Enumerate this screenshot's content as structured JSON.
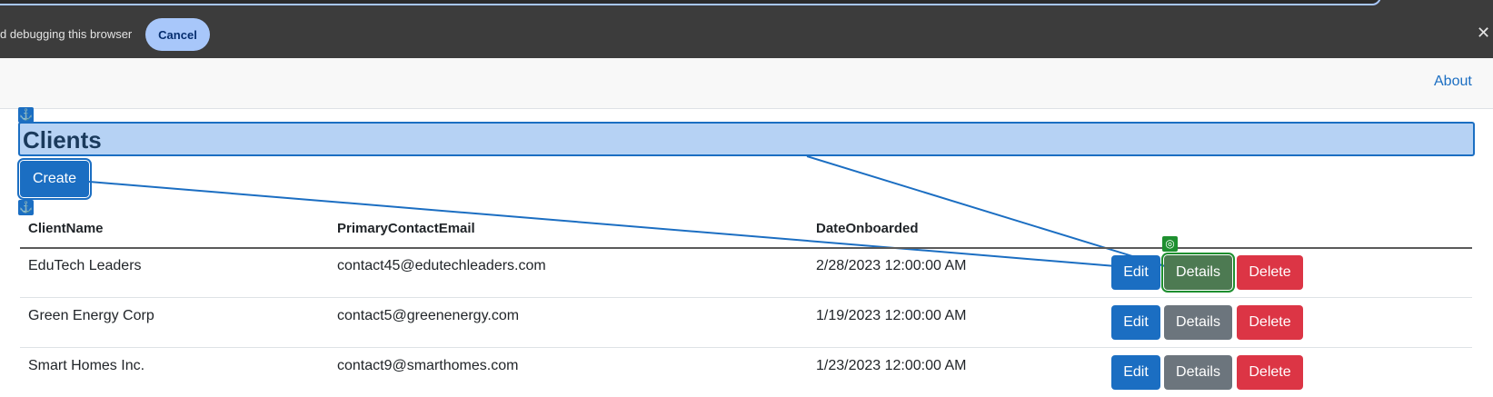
{
  "infobar": {
    "message": "d debugging this browser",
    "cancel_label": "Cancel",
    "close_glyph": "✕"
  },
  "navbar": {
    "about_label": "About"
  },
  "overlay": {
    "anchor_glyph": "⚓",
    "target_glyph": "◎"
  },
  "page": {
    "title": "Clients",
    "create_label": "Create"
  },
  "table": {
    "headers": [
      "ClientName",
      "PrimaryContactEmail",
      "DateOnboarded"
    ],
    "rows": [
      {
        "name": "EduTech Leaders",
        "email": "contact45@edutechleaders.com",
        "date": "2/28/2023 12:00:00 AM"
      },
      {
        "name": "Green Energy Corp",
        "email": "contact5@greenenergy.com",
        "date": "1/19/2023 12:00:00 AM"
      },
      {
        "name": "Smart Homes Inc.",
        "email": "contact9@smarthomes.com",
        "date": "1/23/2023 12:00:00 AM"
      }
    ],
    "actions": {
      "edit": "Edit",
      "details": "Details",
      "delete": "Delete"
    }
  },
  "colors": {
    "primary": "#1b6ec2",
    "secondary": "#6c757d",
    "danger": "#dc3545",
    "highlight": "#b6d2f4",
    "target": "#1e8f2f"
  }
}
